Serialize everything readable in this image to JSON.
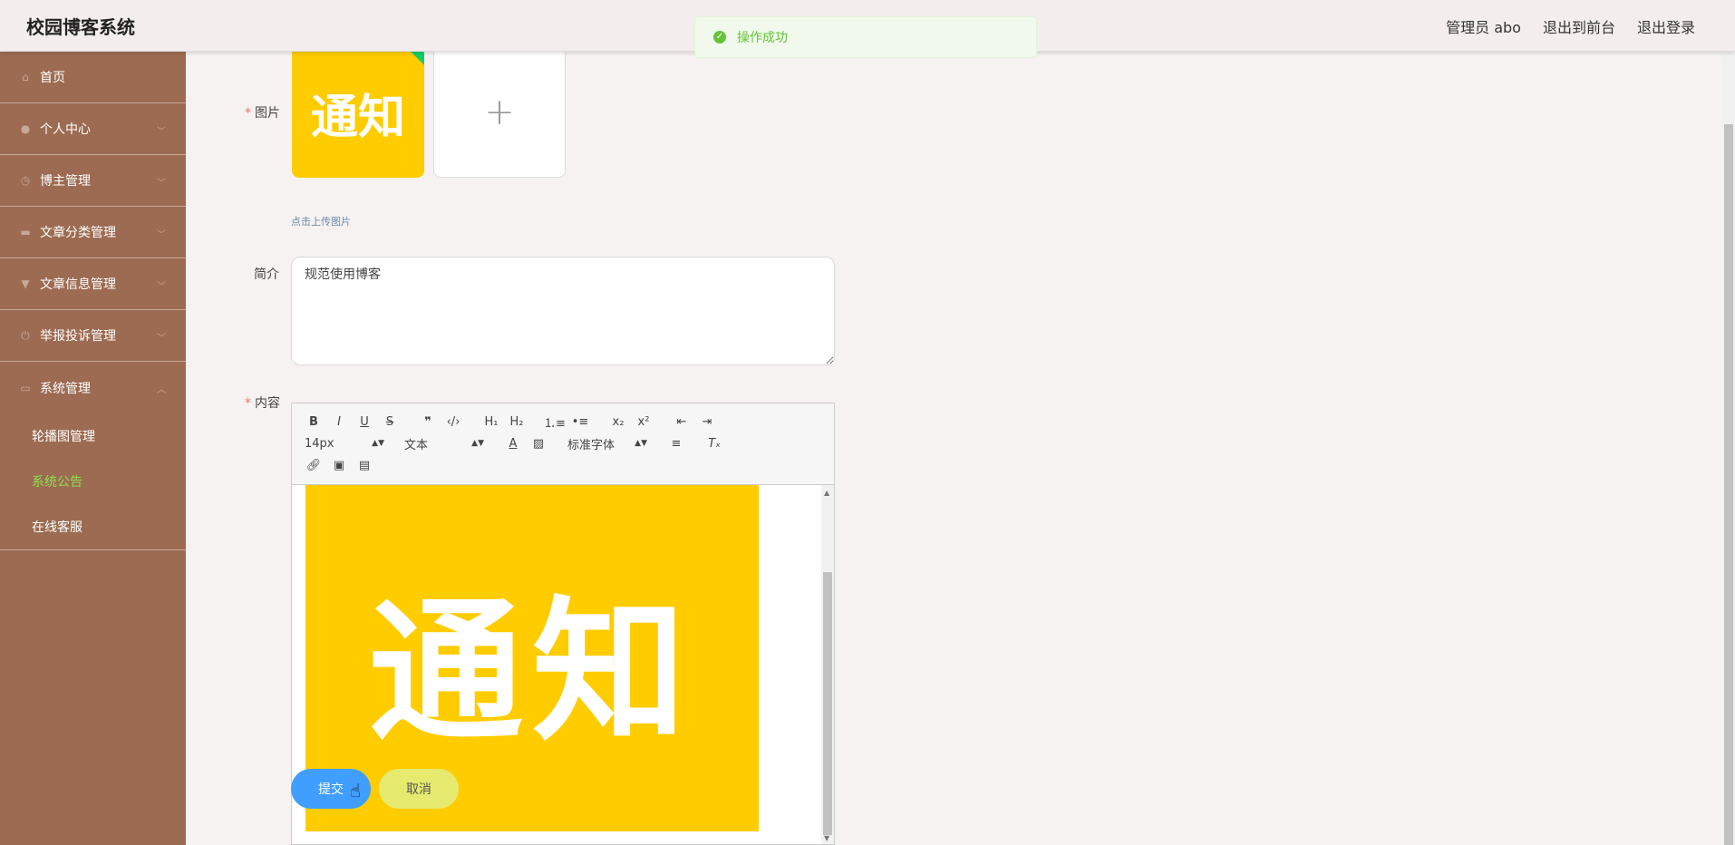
{
  "header": {
    "app_title": "校园博客系统",
    "admin_label": "管理员 abo",
    "exit_front": "退出到前台",
    "logout": "退出登录"
  },
  "toast": {
    "message": "操作成功",
    "icon": "check-circle-icon",
    "color": "#67c23a"
  },
  "sidebar": {
    "items": [
      {
        "label": "首页",
        "icon": "home-icon"
      },
      {
        "label": "个人中心",
        "icon": "user-icon"
      },
      {
        "label": "博主管理",
        "icon": "clock-icon"
      },
      {
        "label": "文章分类管理",
        "icon": "ticket-icon"
      },
      {
        "label": "文章信息管理",
        "icon": "pin-icon"
      },
      {
        "label": "举报投诉管理",
        "icon": "power-icon"
      },
      {
        "label": "系统管理",
        "icon": "chat-icon"
      }
    ],
    "sub_items": [
      {
        "label": "轮播图管理"
      },
      {
        "label": "系统公告",
        "active": true
      },
      {
        "label": "在线客服"
      }
    ],
    "active_color": "#8fe04e",
    "bg_color": "#9c6b52"
  },
  "form": {
    "image_label": "图片",
    "image_text": "通知",
    "upload_plus": "+",
    "upload_tip": "点击上传图片",
    "intro_label": "简介",
    "intro_value": "规范使用博客",
    "content_label": "内容",
    "required_mark": "*"
  },
  "editor": {
    "toolbar": {
      "font_size": "14px",
      "header_select": "文本",
      "font_family": "标准字体"
    },
    "content_image_text": "通知"
  },
  "buttons": {
    "submit": "提交",
    "cancel": "取消"
  }
}
